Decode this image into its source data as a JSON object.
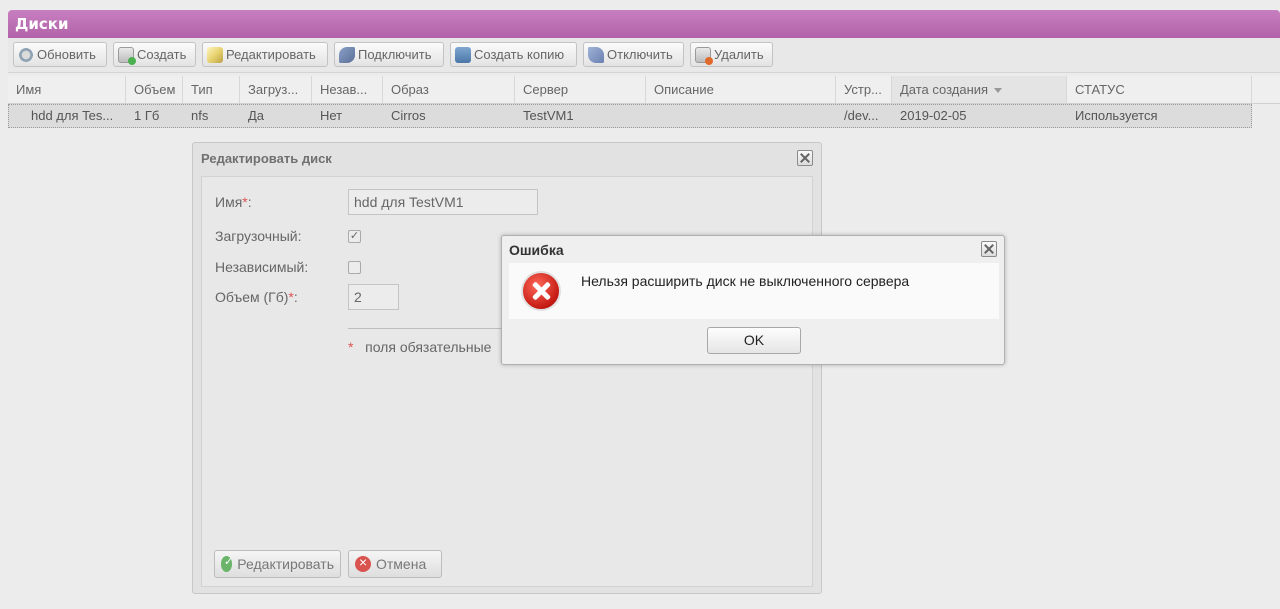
{
  "panel": {
    "title": "Диски"
  },
  "toolbar": {
    "refresh": "Обновить",
    "create": "Создать",
    "edit": "Редактировать",
    "connect": "Подключить",
    "copy": "Создать копию",
    "disconnect": "Отключить",
    "delete": "Удалить"
  },
  "table": {
    "columns": [
      "Имя",
      "Объем",
      "Тип",
      "Загруз...",
      "Незав...",
      "Образ",
      "Сервер",
      "Описание",
      "Устр...",
      "Дата создания",
      "СТАТУС"
    ],
    "rows": [
      [
        "hdd для Tes...",
        "1 Гб",
        "nfs",
        "Да",
        "Нет",
        "Cirros",
        "TestVM1",
        "",
        "/dev...",
        "2019-02-05",
        "Используется"
      ]
    ]
  },
  "edit_dialog": {
    "title": "Редактировать диск",
    "name_label": "Имя",
    "name_value": "hdd для TestVM1",
    "boot_label": "Загрузочный:",
    "boot_checked": true,
    "independent_label": "Независимый:",
    "independent_checked": false,
    "size_label": "Объем (Гб)",
    "size_value": "2",
    "colon": ":",
    "required_mark": "*",
    "required_note": "поля обязательные",
    "save_label": "Редактировать",
    "cancel_label": "Отмена"
  },
  "error_dialog": {
    "title": "Ошибка",
    "message": "Нельзя расширить диск не выключенного сервера",
    "ok_label": "OK"
  },
  "colors": {
    "header_accent": "#b262a8",
    "error_red": "#c41a12"
  }
}
